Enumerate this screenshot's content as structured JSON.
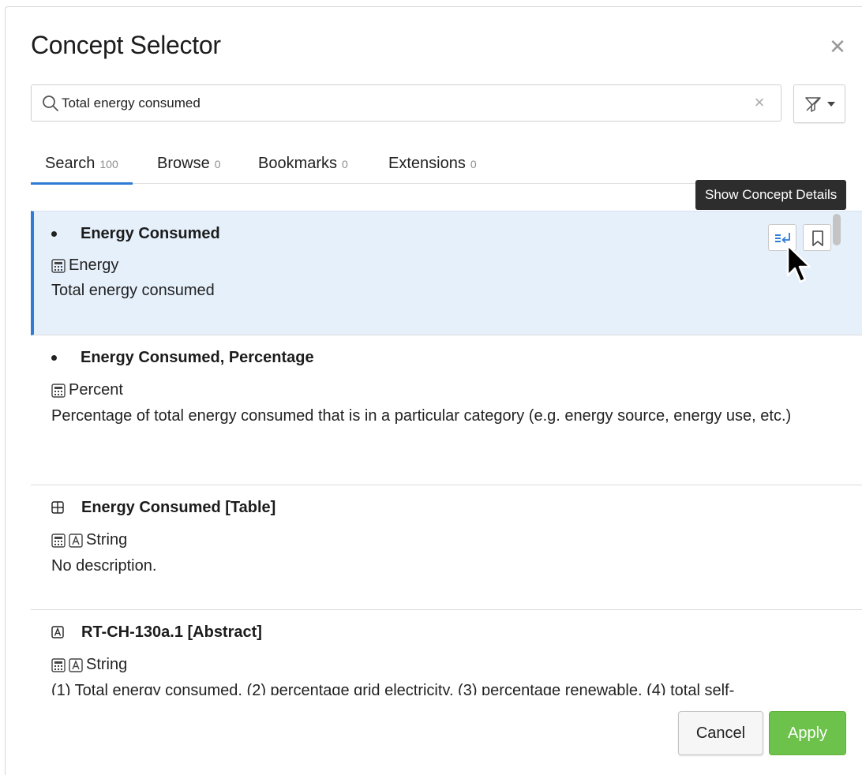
{
  "dialog": {
    "title": "Concept Selector",
    "close_icon": "close-icon"
  },
  "search": {
    "value": "Total energy consumed",
    "placeholder": "",
    "icon": "search-icon",
    "clear_icon": "clear-icon"
  },
  "filter": {
    "icon": "filter-icon",
    "dropdown_icon": "caret-down-icon"
  },
  "tabs": [
    {
      "label": "Search",
      "count": "100",
      "active": true
    },
    {
      "label": "Browse",
      "count": "0",
      "active": false
    },
    {
      "label": "Bookmarks",
      "count": "0",
      "active": false
    },
    {
      "label": "Extensions",
      "count": "0",
      "active": false
    }
  ],
  "tooltip": "Show Concept Details",
  "results": [
    {
      "name": "Energy Consumed",
      "marker": "bullet",
      "type_icons": [
        "calculator-icon"
      ],
      "type": "Energy",
      "description": "Total energy consumed",
      "selected": true
    },
    {
      "name": "Energy Consumed, Percentage",
      "marker": "bullet",
      "type_icons": [
        "calculator-icon"
      ],
      "type": "Percent",
      "description": "Percentage of total energy consumed that is in a particular category (e.g. energy source, energy use, etc.)",
      "selected": false
    },
    {
      "name": "Energy Consumed [Table]",
      "marker": "table-icon",
      "type_icons": [
        "calculator-icon",
        "text-a-icon"
      ],
      "type": "String",
      "description": "No description.",
      "selected": false
    },
    {
      "name": "RT-CH-130a.1 [Abstract]",
      "marker": "abstract-a-icon",
      "type_icons": [
        "calculator-icon",
        "text-a-icon"
      ],
      "type": "String",
      "description": "(1) Total energy consumed, (2) percentage grid electricity, (3) percentage renewable, (4) total self-",
      "selected": false
    }
  ],
  "footer": {
    "cancel_label": "Cancel",
    "apply_label": "Apply"
  },
  "colors": {
    "accent": "#2e7cd6",
    "selected_bg": "#e6f0fb",
    "apply_green": "#6cc24a"
  }
}
